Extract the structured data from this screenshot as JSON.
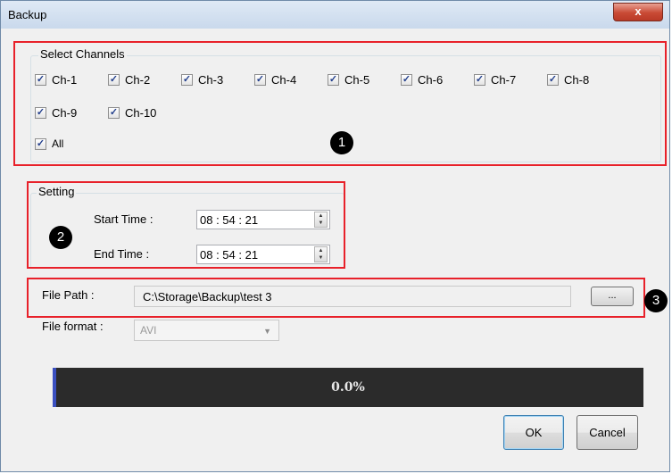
{
  "window": {
    "title": "Backup",
    "close_glyph": "x"
  },
  "channels": {
    "legend": "Select Channels",
    "items": [
      {
        "label": "Ch-1",
        "checked": true
      },
      {
        "label": "Ch-2",
        "checked": true
      },
      {
        "label": "Ch-3",
        "checked": true
      },
      {
        "label": "Ch-4",
        "checked": true
      },
      {
        "label": "Ch-5",
        "checked": true
      },
      {
        "label": "Ch-6",
        "checked": true
      },
      {
        "label": "Ch-7",
        "checked": true
      },
      {
        "label": "Ch-8",
        "checked": true
      },
      {
        "label": "Ch-9",
        "checked": true
      },
      {
        "label": "Ch-10",
        "checked": true
      }
    ],
    "all": {
      "label": "All",
      "checked": true
    }
  },
  "setting": {
    "legend": "Setting",
    "start_label": "Start Time :",
    "start_value": "08 : 54 : 21",
    "end_label": "End Time  :",
    "end_value": "08 : 54 : 21"
  },
  "file": {
    "path_label": "File Path :",
    "path_value": "C:\\Storage\\Backup\\test 3",
    "browse_label": "...",
    "format_label": "File format :",
    "format_value": "AVI"
  },
  "progress": {
    "text": "0.0%",
    "fraction": 0.0
  },
  "buttons": {
    "ok": "OK",
    "cancel": "Cancel"
  },
  "annotations": {
    "badge1": "1",
    "badge2": "2",
    "badge3": "3",
    "highlight_color": "#e8212a"
  },
  "checkmark": "✓"
}
